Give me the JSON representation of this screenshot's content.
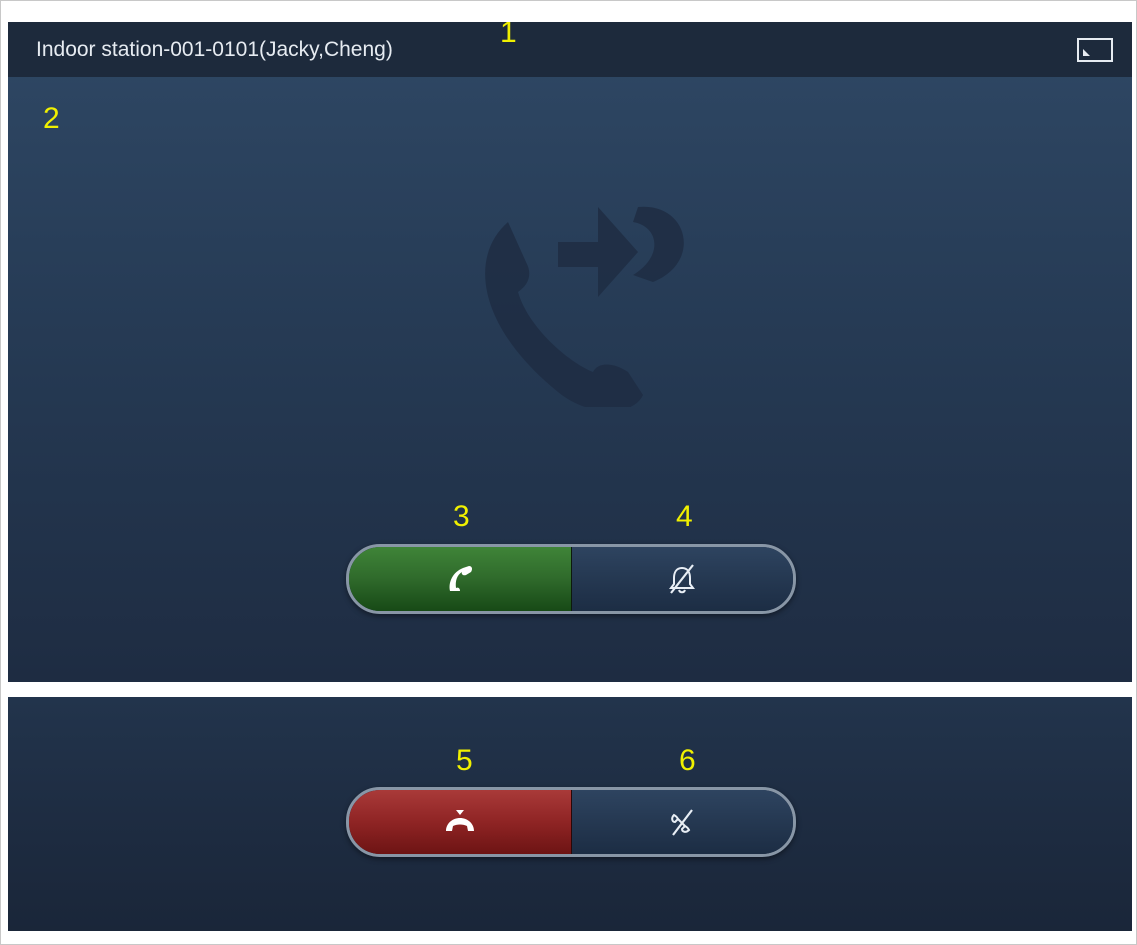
{
  "header": {
    "title": "Indoor station-001-0101(Jacky,Cheng)",
    "window_icon": "screen-mode-icon"
  },
  "callouts": [
    "1",
    "2",
    "3",
    "4",
    "5",
    "6"
  ],
  "incoming_call": {
    "background_icon": "phone-forward-icon",
    "buttons": [
      {
        "name": "answer",
        "icon": "phone-answer-icon",
        "color": "#2f6a2b"
      },
      {
        "name": "mute-ringtone",
        "icon": "bell-muted-icon",
        "color": "#243750"
      }
    ]
  },
  "active_call": {
    "buttons": [
      {
        "name": "hang-up",
        "icon": "phone-hangup-icon",
        "color": "#8f2424"
      },
      {
        "name": "mute-microphone",
        "icon": "mic-muted-icon",
        "color": "#243750"
      }
    ]
  },
  "colors": {
    "callout": "#f0f000",
    "title_bar": "#1d2a3c",
    "screen": "#263b55"
  }
}
